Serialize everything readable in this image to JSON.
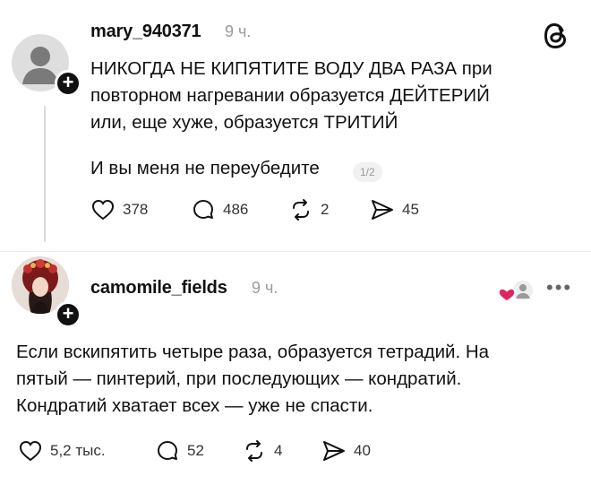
{
  "app": {
    "logo": "threads-logo-icon"
  },
  "posts": [
    {
      "username": "mary_940371",
      "time": "9 ч.",
      "text": "НИКОГДА НЕ КИПЯТИТЕ ВОДУ ДВА РАЗА при\nповторном нагревании образуется ДЕЙТЕРИЙ\nили, еще хуже, образуется ТРИТИЙ",
      "text2": "И вы меня не переубедите",
      "page_indicator": "1/2",
      "likes": "378",
      "replies": "486",
      "reposts": "2",
      "shares": "45"
    },
    {
      "username": "camomile_fields",
      "time": "9 ч.",
      "text": "Если вскипятить четыре раза, образуется тетрадий. На\nпятый — пинтерий, при последующих — кондратий.\nКондратий хватает всех — уже не спасти.",
      "likes": "5,2 тыс.",
      "replies": "52",
      "reposts": "4",
      "shares": "40"
    }
  ],
  "colors": {
    "text": "#111111",
    "muted": "#9a9a9a",
    "like_red": "#e0245e"
  }
}
